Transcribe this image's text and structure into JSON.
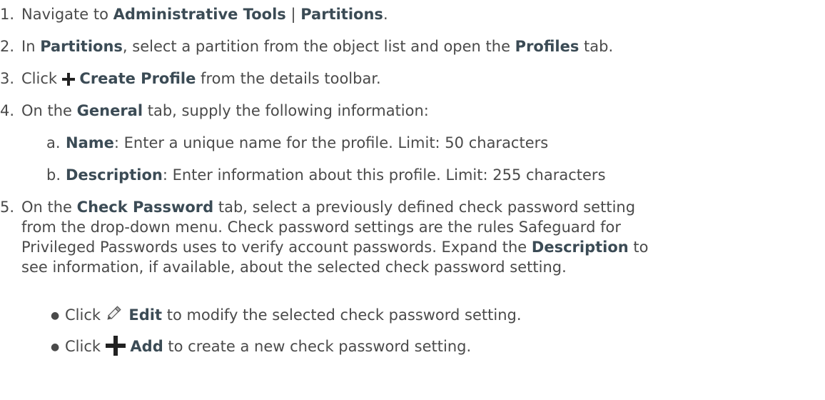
{
  "steps": [
    {
      "num": "1.",
      "parts": [
        "Navigate to ",
        "Administrative Tools",
        " | ",
        "Partitions",
        "."
      ]
    },
    {
      "num": "2.",
      "parts": [
        "In ",
        "Partitions",
        ", select a partition from the object list and open the ",
        "Profiles",
        " tab."
      ]
    },
    {
      "num": "3.",
      "parts": [
        "Click ",
        "Create Profile",
        " from the details toolbar."
      ]
    },
    {
      "num": "4.",
      "parts": [
        "On the ",
        "General",
        " tab, supply the following information:"
      ]
    },
    {
      "num": "5.",
      "lines": [
        [
          "On the ",
          "Check Password",
          " tab, select a previously defined check password setting"
        ],
        [
          "from the drop-down menu. Check password settings are the rules Safeguard for"
        ],
        [
          "Privileged Passwords uses to verify account passwords. Expand the ",
          "Description",
          " to"
        ],
        [
          "see information, if available, about the selected check password setting."
        ]
      ]
    }
  ],
  "substeps": [
    {
      "letter": "a.",
      "parts": [
        "Name",
        ": Enter a unique name for the profile. Limit: 50 characters"
      ]
    },
    {
      "letter": "b.",
      "parts": [
        "Description",
        ": Enter information about this profile. Limit: 255 characters"
      ]
    }
  ],
  "bullets": [
    {
      "bullet": "●",
      "parts": [
        "Click ",
        "Edit",
        " to modify the selected check password setting."
      ]
    },
    {
      "bullet": "●",
      "parts": [
        "Click ",
        "Add",
        " to create a new check password setting."
      ]
    }
  ]
}
